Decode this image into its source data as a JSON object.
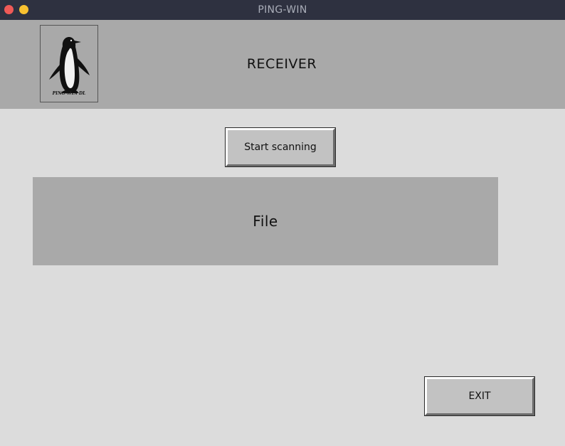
{
  "window": {
    "title": "PING-WIN"
  },
  "header": {
    "logo_text": "PING-WIN DL",
    "title": "RECEIVER"
  },
  "actions": {
    "scan_label": "Start scanning",
    "exit_label": "EXIT"
  },
  "file_panel": {
    "label": "File"
  },
  "colors": {
    "titlebar": "#2e3140",
    "header_bg": "#a9a9a9",
    "body_bg": "#dcdcdc",
    "button_bg": "#c2c2c2",
    "close_dot": "#f05a57",
    "minimize_dot": "#f8c130"
  },
  "icons": {
    "logo": "penguin-logo"
  }
}
